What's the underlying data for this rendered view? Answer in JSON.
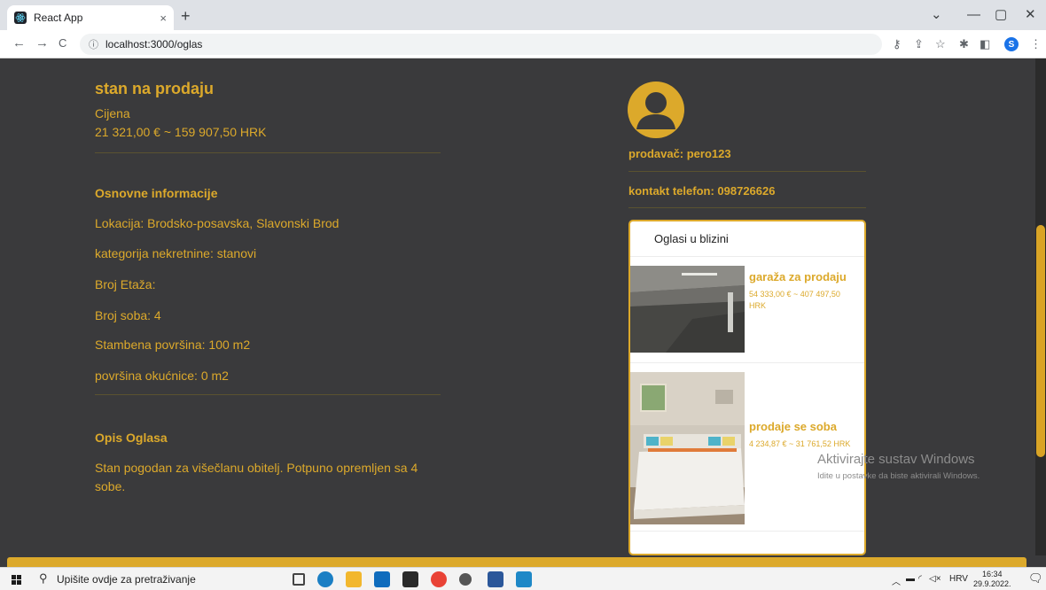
{
  "browser": {
    "tab_title": "React App",
    "tab_close": "×",
    "new_tab": "+",
    "url": "localhost:3000/oglas",
    "profile_initial": "S",
    "window_controls": {
      "minimize": "—",
      "maximize": "▢",
      "close": "✕",
      "tab_search": "⌄"
    },
    "nav": {
      "back": "←",
      "forward": "→",
      "reload": "C"
    }
  },
  "listing": {
    "title": "stan na prodaju",
    "price_label": "Cijena",
    "price_value": "21 321,00 € ~ 159 907,50 HRK",
    "basic_info_heading": "Osnovne informacije",
    "location": "Lokacija: Brodsko-posavska, Slavonski Brod",
    "category": "kategorija nekretnine: stanovi",
    "floors": "Broj Etaža:",
    "rooms": "Broj soba: 4",
    "living_area": "Stambena površina: 100 m2",
    "yard_area": "površina okućnice: 0 m2",
    "description_heading": "Opis Oglasa",
    "description": "Stan pogodan za višečlanu obitelj. Potpuno opremljen sa 4 sobe."
  },
  "seller": {
    "name_line": "prodavač: pero123",
    "phone_line": "kontakt telefon: 098726626"
  },
  "nearby": {
    "heading": "Oglasi u blizini",
    "items": [
      {
        "title": "garaža za prodaju",
        "price": "54 333,00 € ~ 407 497,50 HRK"
      },
      {
        "title": "prodaje se soba",
        "price": "4 234,87 € ~ 31 761,52 HRK"
      }
    ]
  },
  "watermark": {
    "line1": "Aktivirajte sustav Windows",
    "line2": "Idite u postavke da biste aktivirali Windows."
  },
  "taskbar": {
    "search_placeholder": "Upišite ovdje za pretraživanje",
    "language": "HRV",
    "time": "16:34",
    "date": "29.9.2022."
  },
  "colors": {
    "accent": "#dca92b",
    "page_background": "#3a3a3c"
  }
}
